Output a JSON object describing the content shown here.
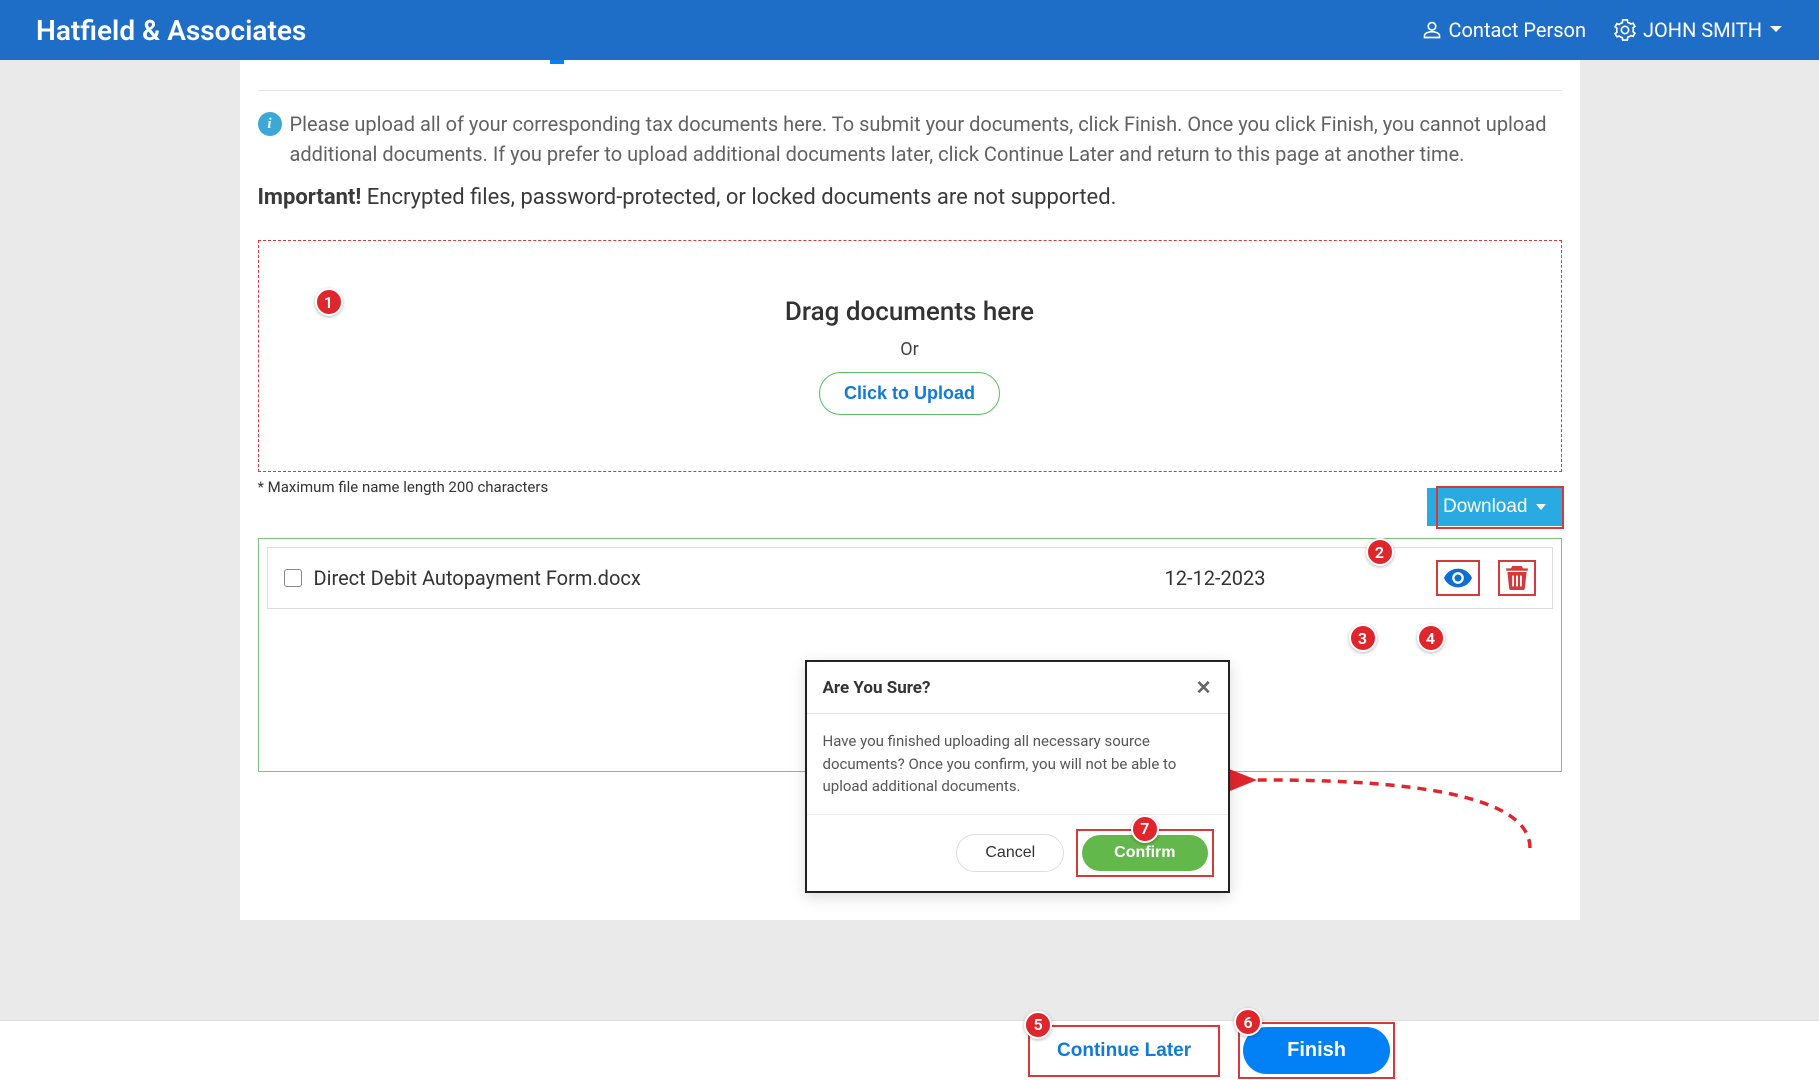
{
  "header": {
    "brand": "Hatfield & Associates",
    "contact_label": "Contact Person",
    "user_name": "JOHN SMITH"
  },
  "info": {
    "text": "Please upload all of your corresponding tax documents here. To submit your documents, click Finish. Once you click Finish, you cannot upload additional documents. If you prefer to upload additional documents later, click Continue Later and return to this page at another time."
  },
  "important": {
    "prefix": "Important!",
    "text": " Encrypted files, password-protected, or locked documents are not supported."
  },
  "dropzone": {
    "title": "Drag documents here",
    "or": "Or",
    "button": "Click to Upload",
    "note": "* Maximum file name length 200 characters"
  },
  "download_label": "Download",
  "file": {
    "name": "Direct Debit Autopayment Form.docx",
    "date": "12-12-2023"
  },
  "modal": {
    "title": "Are You Sure?",
    "body": "Have you finished uploading all necessary source documents? Once you confirm, you will not be able to upload additional documents.",
    "cancel": "Cancel",
    "confirm": "Confirm"
  },
  "footer": {
    "continue": "Continue Later",
    "finish": "Finish"
  },
  "callouts": {
    "c1": "1",
    "c2": "2",
    "c3": "3",
    "c4": "4",
    "c5": "5",
    "c6": "6",
    "c7": "7"
  }
}
